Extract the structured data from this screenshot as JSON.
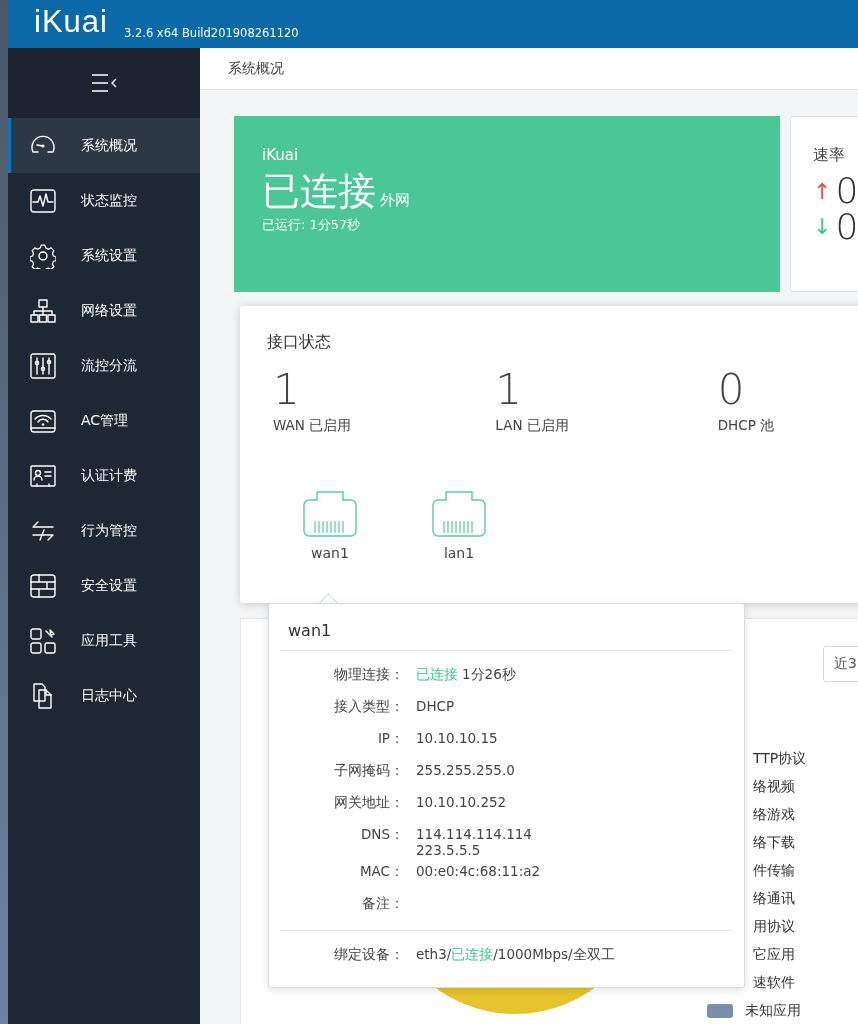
{
  "header": {
    "logo": "iKuai",
    "version": "3.2.6 x64 Build201908261120"
  },
  "sidebar": {
    "items": [
      {
        "label": "系统概况",
        "selected": true
      },
      {
        "label": "状态监控",
        "selected": false
      },
      {
        "label": "系统设置",
        "selected": false
      },
      {
        "label": "网络设置",
        "selected": false
      },
      {
        "label": "流控分流",
        "selected": false
      },
      {
        "label": "AC管理",
        "selected": false
      },
      {
        "label": "认证计费",
        "selected": false
      },
      {
        "label": "行为管控",
        "selected": false
      },
      {
        "label": "安全设置",
        "selected": false
      },
      {
        "label": "应用工具",
        "selected": false
      },
      {
        "label": "日志中心",
        "selected": false
      }
    ]
  },
  "breadcrumb": "系统概况",
  "status_card": {
    "title": "iKuai",
    "status": "已连接",
    "network": "外网",
    "uptime": "已运行: 1分57秒"
  },
  "speed_card": {
    "title": "速率",
    "rates": [
      {
        "kind": "up",
        "arrow": "↑",
        "value": "0"
      },
      {
        "kind": "down",
        "arrow": "↓",
        "value": "0"
      }
    ]
  },
  "interfaces": {
    "title": "接口状态",
    "stats": [
      {
        "value": "1",
        "label": "WAN 已启用"
      },
      {
        "value": "1",
        "label": "LAN 已启用"
      },
      {
        "value": "0",
        "label": "DHCP 池"
      }
    ],
    "ports": [
      {
        "name": "wan1"
      },
      {
        "name": "lan1"
      }
    ]
  },
  "tooltip": {
    "title": "wan1",
    "rows": [
      {
        "label": "物理连接：",
        "segments": [
          {
            "text": "已连接",
            "kind": "ok"
          },
          {
            "text": "1分26秒",
            "kind": "plain"
          }
        ]
      },
      {
        "label": "接入类型：",
        "segments": [
          {
            "text": "DHCP",
            "kind": "plain"
          }
        ]
      },
      {
        "label": "IP：",
        "segments": [
          {
            "text": "10.10.10.15",
            "kind": "plain"
          }
        ]
      },
      {
        "label": "子网掩码：",
        "segments": [
          {
            "text": "255.255.255.0",
            "kind": "plain"
          }
        ]
      },
      {
        "label": "网关地址：",
        "segments": [
          {
            "text": "10.10.10.252",
            "kind": "plain"
          }
        ]
      },
      {
        "label": "DNS：",
        "segments": [
          {
            "text": "114.114.114.114",
            "kind": "line"
          },
          {
            "text": "223.5.5.5",
            "kind": "line"
          }
        ]
      },
      {
        "label": "MAC：",
        "segments": [
          {
            "text": "00:e0:4c:68:11:a2",
            "kind": "plain"
          }
        ]
      },
      {
        "label": "备注："
      }
    ],
    "footer": {
      "label": "绑定设备：",
      "segments": [
        {
          "text": "eth3/",
          "kind": "plain"
        },
        {
          "text": "已连接",
          "kind": "ok"
        },
        {
          "text": "/1000Mbps/全双工",
          "kind": "plain"
        }
      ]
    }
  },
  "app_card": {
    "range_button": "近3",
    "legend": [
      {
        "label": "TTP协议"
      },
      {
        "label": "络视频"
      },
      {
        "label": "络游戏"
      },
      {
        "label": "络下载"
      },
      {
        "label": "件传输"
      },
      {
        "label": "络通讯"
      },
      {
        "label": "用协议"
      },
      {
        "label": "它应用"
      },
      {
        "label": "速软件"
      },
      {
        "label": "未知应用",
        "color": "#7f8ea8"
      }
    ]
  }
}
